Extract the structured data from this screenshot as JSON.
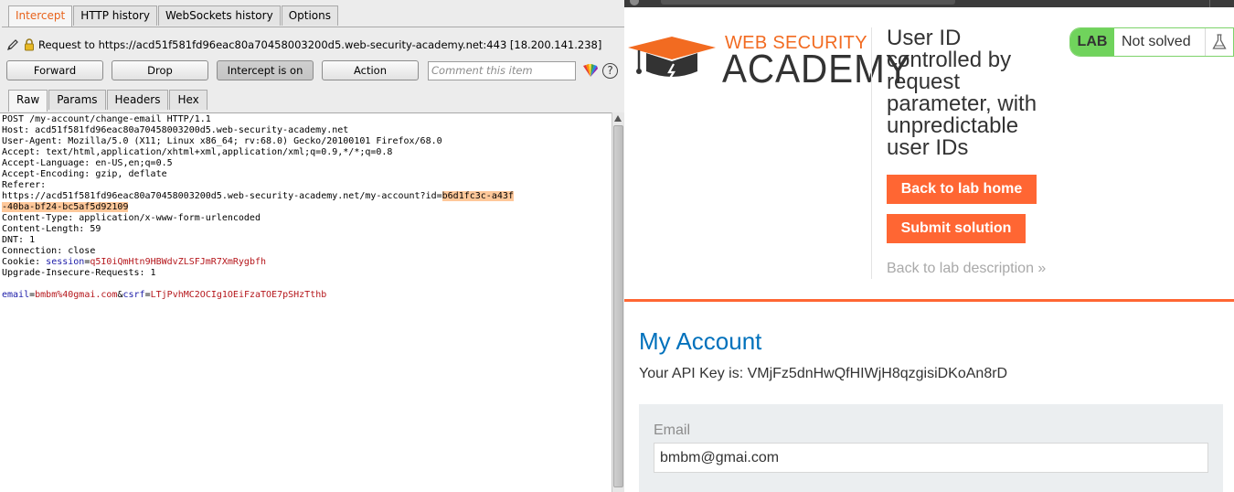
{
  "burp": {
    "top_tabs": [
      "Intercept",
      "HTTP history",
      "WebSockets history",
      "Options"
    ],
    "request_label": "Request to https://acd51f581fd96eac80a70458003200d5.web-security-academy.net:443  [18.200.141.238]",
    "buttons": {
      "forward": "Forward",
      "drop": "Drop",
      "intercept": "Intercept is on",
      "action": "Action"
    },
    "comment_placeholder": "Comment this item",
    "help": "?",
    "view_tabs": [
      "Raw",
      "Params",
      "Headers",
      "Hex"
    ],
    "request": {
      "lines": [
        "POST /my-account/change-email HTTP/1.1",
        "Host: acd51f581fd96eac80a70458003200d5.web-security-academy.net",
        "User-Agent: Mozilla/5.0 (X11; Linux x86_64; rv:68.0) Gecko/20100101 Firefox/68.0",
        "Accept: text/html,application/xhtml+xml,application/xml;q=0.9,*/*;q=0.8",
        "Accept-Language: en-US,en;q=0.5",
        "Accept-Encoding: gzip, deflate",
        "Referer:"
      ],
      "referer_url": "https://acd51f581fd96eac80a70458003200d5.web-security-academy.net/my-account?id=",
      "referer_id_part1": "b6d1fc3c-a43f",
      "referer_id_part2": "-40ba-bf24-bc5af5d92109",
      "lines_after": [
        "Content-Type: application/x-www-form-urlencoded",
        "Content-Length: 59",
        "DNT: 1",
        "Connection: close"
      ],
      "cookie_prefix": "Cookie: ",
      "cookie_name": "session",
      "cookie_eq": "=",
      "cookie_value": "q5I0iQmHtn9HBWdvZLSFJmR7XmRygbfh",
      "upgrade_line": "Upgrade-Insecure-Requests: 1",
      "body_k1": "email",
      "body_v1": "bmbm%40gmai.com",
      "body_amp": "&",
      "body_k2": "csrf",
      "body_v2": "LTjPvhMC2OCIg1OEiFzaTOE7pSHzTthb"
    }
  },
  "lab": {
    "logo_top": "WEB SECURITY",
    "logo_bottom": "ACADEMY",
    "title": "User ID controlled by request parameter, with unpredictable user IDs",
    "back_home": "Back to lab home",
    "submit": "Submit solution",
    "back_desc": "Back to lab description »",
    "status_tag": "LAB",
    "status_text": "Not solved",
    "my_account": "My Account",
    "api_key": "Your API Key is: VMjFz5dnHwQfHIWjH8qzgisiDKoAn8rD",
    "email_label": "Email",
    "email_value": "bmbm@gmai.com"
  },
  "colors": {
    "accent": "#ff6633",
    "burp_orange": "#e8631c",
    "link_blue": "#0071bc",
    "lab_green": "#70d35c"
  }
}
